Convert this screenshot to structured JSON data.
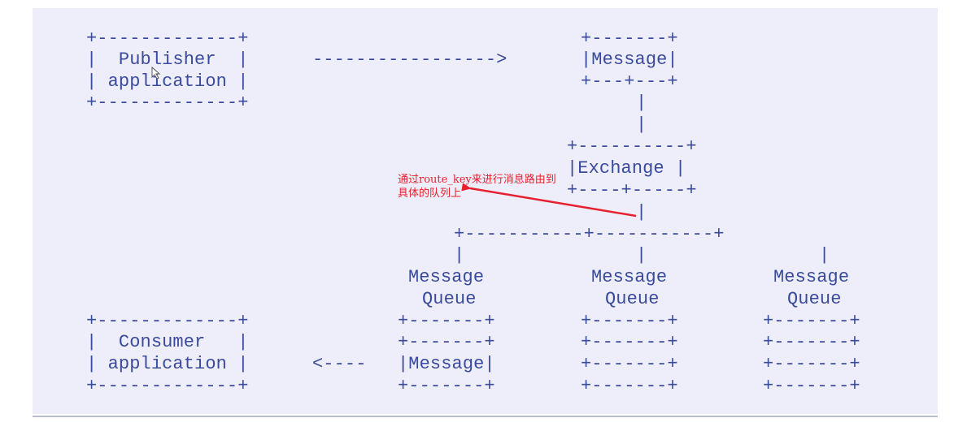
{
  "diagram": {
    "lines": [
      "      +-------------+            +-------+",
      "      |  Publisher  | -----------> |Message|",
      "      | application |            +---+---+",
      "      +-------------+                |",
      "                                     |",
      "                              +--------+",
      "                              |Exchange |",
      "                              +---+----+",
      "                                  |",
      "                     +-----------+-----------+",
      "                     |           |           |",
      "                   Message     Message     Message",
      "                    Queue       Queue       Queue",
      "      +-------------+   +-------+   +-------+   +-------+",
      "      |  Consumer   |   +-------+   +-------+   +-------+",
      "      | application | <---- |Message|   +-------+   +-------+",
      "      +-------------+   +-------+   +-------+   +-------+"
    ]
  },
  "annotation": {
    "line1": "通过route_key来进行消息路由到",
    "line2": "具体的队列上",
    "color": "#e8202e"
  },
  "colors": {
    "text": "#3a4a9c",
    "panel": "#eeeefa"
  }
}
